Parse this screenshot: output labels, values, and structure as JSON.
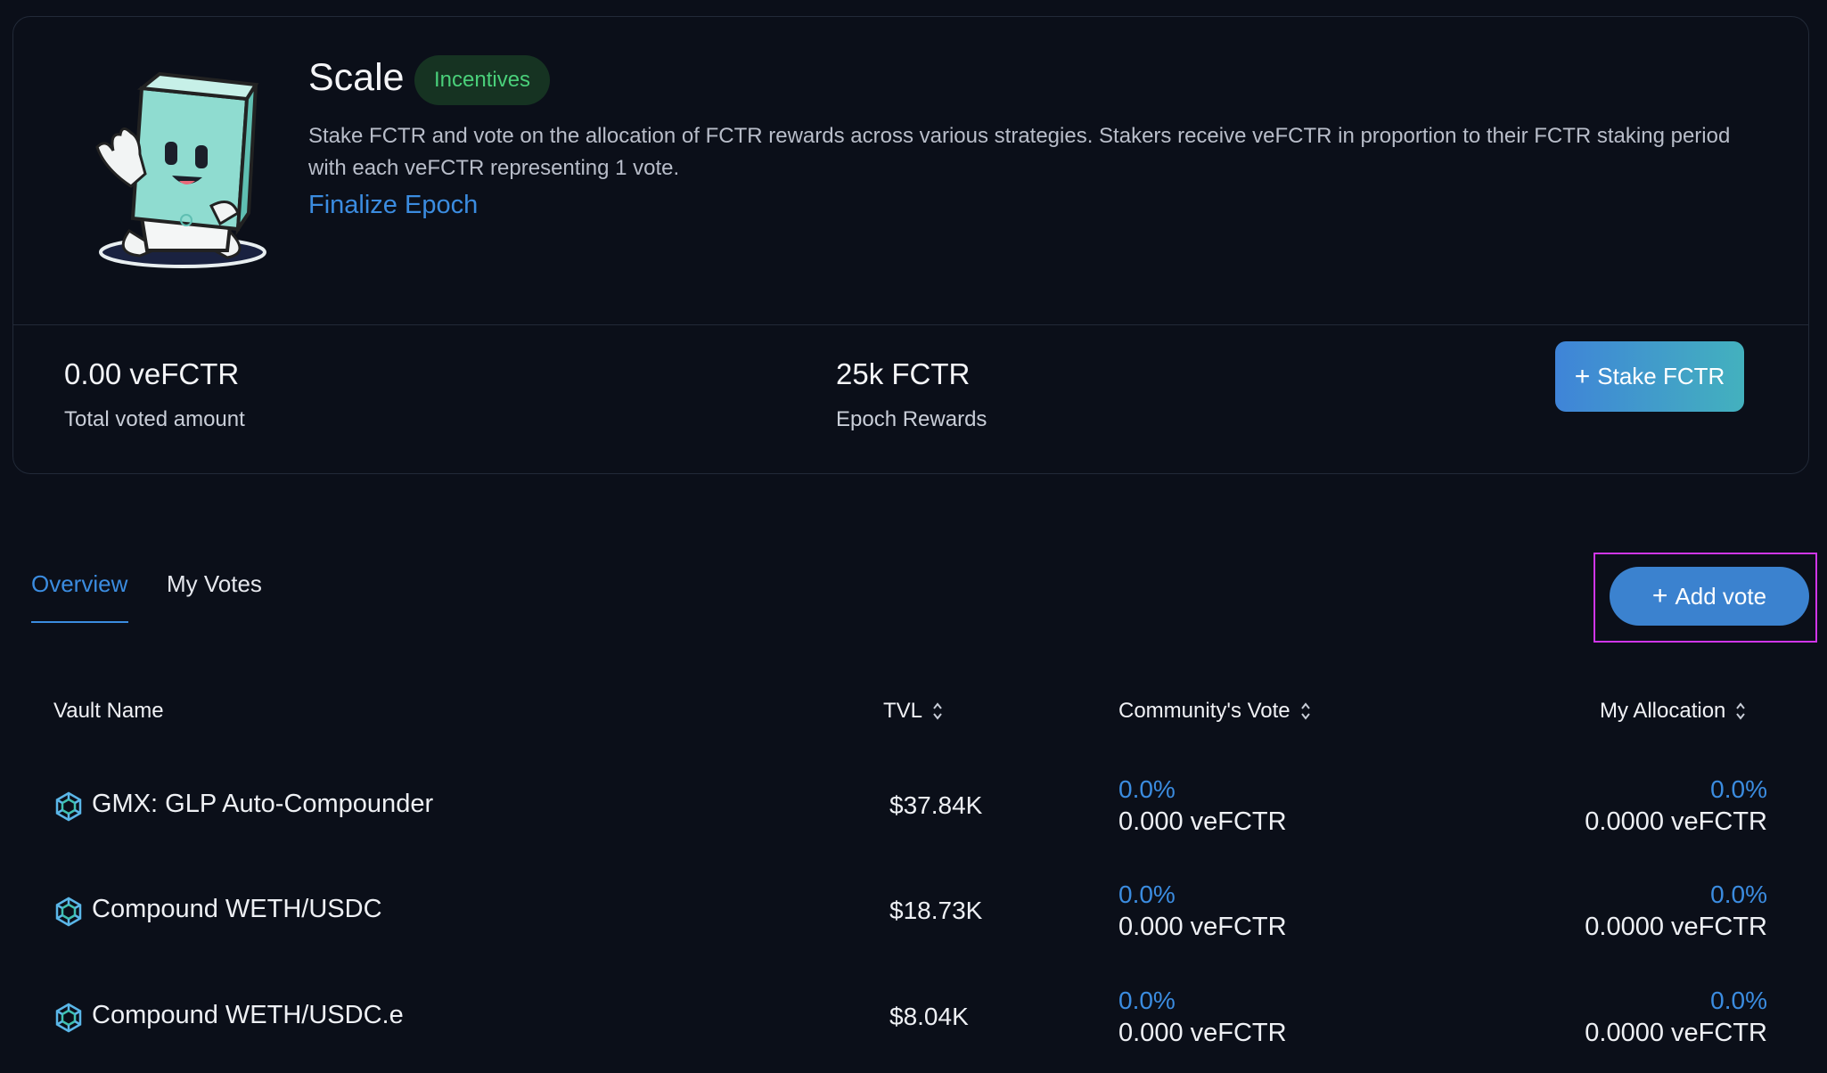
{
  "header": {
    "title": "Scale",
    "badge": "Incentives",
    "description": "Stake FCTR and vote on the allocation of FCTR rewards across various strategies. Stakers receive veFCTR in proportion to their FCTR staking period with each veFCTR representing 1 vote.",
    "finalize_link": "Finalize Epoch"
  },
  "stats": {
    "total_voted_value": "0.00 veFCTR",
    "total_voted_label": "Total voted amount",
    "epoch_rewards_value": "25k FCTR",
    "epoch_rewards_label": "Epoch Rewards",
    "stake_button": "Stake FCTR"
  },
  "tabs": [
    {
      "label": "Overview",
      "active": true
    },
    {
      "label": "My Votes",
      "active": false
    }
  ],
  "add_vote_button": "Add vote",
  "table": {
    "columns": [
      "Vault Name",
      "TVL",
      "Community's Vote",
      "My Allocation"
    ],
    "rows": [
      {
        "name": "GMX: GLP Auto-Compounder",
        "tvl": "$37.84K",
        "community_pct": "0.0%",
        "community_amt": "0.000 veFCTR",
        "my_pct": "0.0%",
        "my_amt": "0.0000 veFCTR"
      },
      {
        "name": "Compound WETH/USDC",
        "tvl": "$18.73K",
        "community_pct": "0.0%",
        "community_amt": "0.000 veFCTR",
        "my_pct": "0.0%",
        "my_amt": "0.0000 veFCTR"
      },
      {
        "name": "Compound WETH/USDC.e",
        "tvl": "$8.04K",
        "community_pct": "0.0%",
        "community_amt": "0.000 veFCTR",
        "my_pct": "0.0%",
        "my_amt": "0.0000 veFCTR"
      }
    ]
  },
  "colors": {
    "accent": "#3b8ce0",
    "badge_text": "#4ad07a",
    "badge_bg": "#163322",
    "background": "#0b0f19",
    "highlight_frame": "#d036e8"
  },
  "icons": [
    "mascot-illustration",
    "plus-icon",
    "sort-icon",
    "vault-icon"
  ]
}
